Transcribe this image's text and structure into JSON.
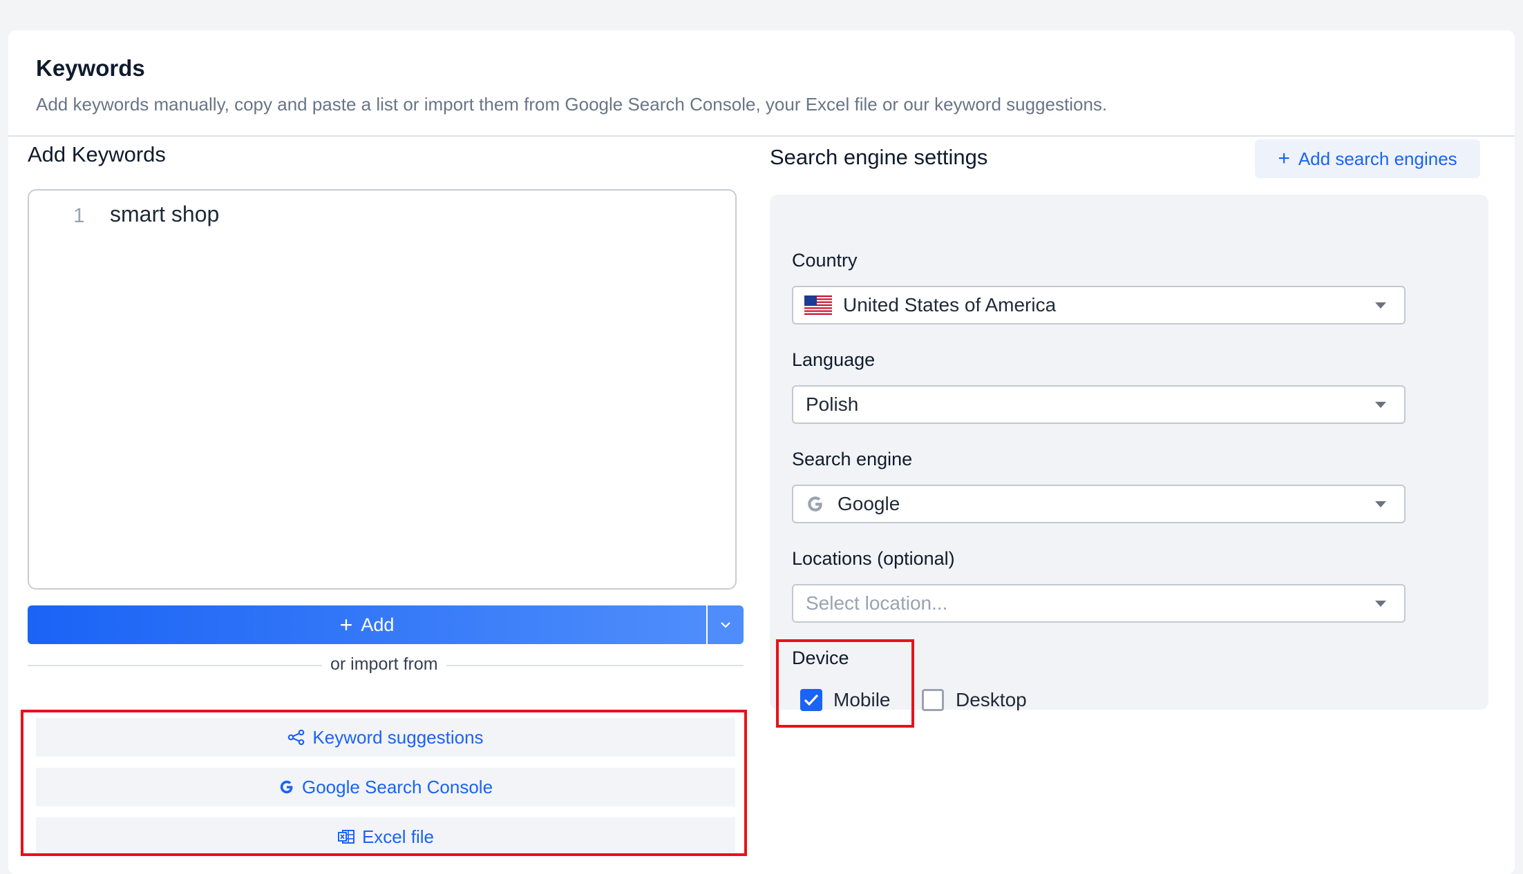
{
  "header": {
    "title": "Keywords",
    "subtitle": "Add keywords manually, copy and paste a list or import them from Google Search Console, your Excel file or our keyword suggestions."
  },
  "add_keywords": {
    "title": "Add Keywords",
    "lines": [
      {
        "number": "1",
        "text": "smart shop"
      }
    ],
    "add_button_label": "Add",
    "divider_text": "or import from",
    "import_options": [
      {
        "label": "Keyword suggestions",
        "icon": "share-nodes-icon"
      },
      {
        "label": "Google Search Console",
        "icon": "google-g-icon"
      },
      {
        "label": "Excel file",
        "icon": "excel-icon"
      }
    ]
  },
  "search_engine_settings": {
    "title": "Search engine settings",
    "add_engines_label": "Add search engines",
    "country": {
      "label": "Country",
      "value": "United States of America",
      "icon": "us-flag-icon"
    },
    "language": {
      "label": "Language",
      "value": "Polish"
    },
    "search_engine": {
      "label": "Search engine",
      "value": "Google",
      "icon": "google-g-icon"
    },
    "locations": {
      "label": "Locations (optional)",
      "placeholder": "Select location..."
    },
    "device": {
      "label": "Device",
      "options": [
        {
          "label": "Mobile",
          "checked": true
        },
        {
          "label": "Desktop",
          "checked": false
        }
      ]
    }
  },
  "colors": {
    "accent": "#1a63f5",
    "highlight_border": "#e8111a",
    "panel_bg": "#f2f3f6"
  }
}
